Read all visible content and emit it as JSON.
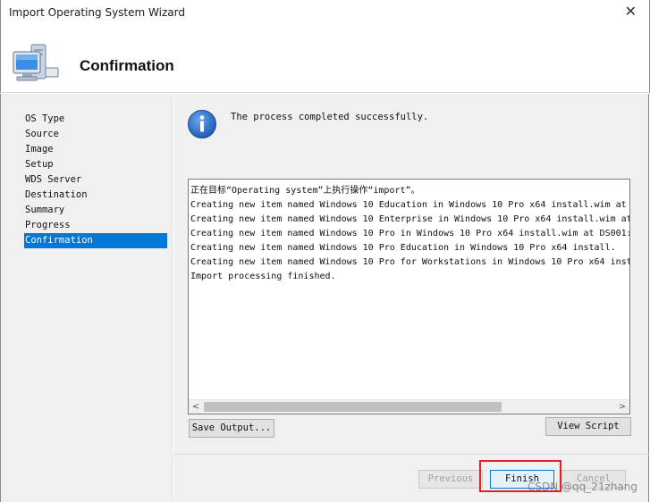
{
  "window": {
    "title": "Import Operating System Wizard",
    "close_glyph": "✕"
  },
  "header": {
    "heading": "Confirmation",
    "icon": "computer-icon"
  },
  "sidebar": {
    "items": [
      {
        "label": "OS Type"
      },
      {
        "label": "Source"
      },
      {
        "label": "Image"
      },
      {
        "label": "Setup"
      },
      {
        "label": "WDS Server"
      },
      {
        "label": "Destination"
      },
      {
        "label": "Summary"
      },
      {
        "label": "Progress"
      },
      {
        "label": "Confirmation"
      }
    ],
    "active": "Confirmation",
    "active_color": "#0078d7"
  },
  "main": {
    "status_icon": "info-icon",
    "status_text": "The process completed successfully.",
    "log_lines": [
      "正在目标“Operating system”上执行操作“import”。",
      "Creating new item named Windows 10 Education in Windows 10 Pro x64 install.wim at",
      "Creating new item named Windows 10 Enterprise in Windows 10 Pro x64 install.wim at",
      "Creating new item named Windows 10 Pro in Windows 10 Pro x64 install.wim at DS001:",
      "Creating new item named Windows 10 Pro Education in Windows 10 Pro x64 install.",
      "Creating new item named Windows 10 Pro for Workstations in Windows 10 Pro x64 inst",
      "Import processing finished."
    ],
    "scroll_left": "<",
    "scroll_right": ">",
    "save_output_label": "Save Output...",
    "view_script_label": "View Script"
  },
  "buttons": {
    "previous_label": "Previous",
    "finish_label": "Finish",
    "cancel_label": "Cancel"
  },
  "watermark": "CSDN @qq_21zhang",
  "colors": {
    "highlight": "#e0212a",
    "info_blue": "#1f5bb5"
  }
}
